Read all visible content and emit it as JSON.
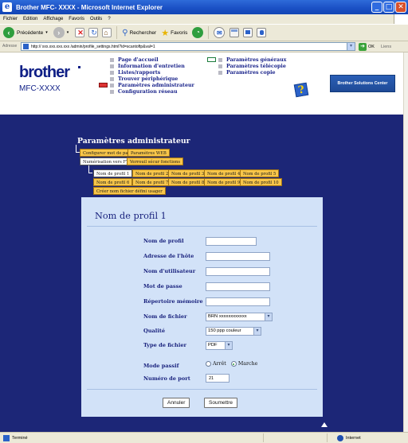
{
  "window": {
    "title": "Brother MFC- XXXX - Microsoft Internet Explorer",
    "min": "_",
    "max": "□",
    "close": "✕"
  },
  "menu": [
    "Fichier",
    "Edition",
    "Affichage",
    "Favoris",
    "Outils",
    "?"
  ],
  "toolbar": {
    "back": "Précédente",
    "search": "Rechercher",
    "favorites": "Favoris"
  },
  "address": {
    "label": "Adresse",
    "url": "http:// xxx.xxx.xxx.xxx /admin/profile_settings.html?id=scantoftp&val=1",
    "go": "OK",
    "links": "Liens"
  },
  "header": {
    "logo": "brother",
    "model": "MFC-XXXX",
    "nav_left": [
      "Page d'accueil",
      "Information d'entretien",
      "Listes/rapports",
      "Trouver périphérique",
      "Paramètres administrateur",
      "Configuration réseau"
    ],
    "nav_right": [
      "Paramètres généraux",
      "Paramètres télécopie",
      "Paramètres copie"
    ],
    "help": "?",
    "solutions_center": "Brother Solutions Center"
  },
  "section": {
    "title": "Paramètres administrateur",
    "tabs_row1": [
      "Configurer mot de passe",
      "Paramètres WEB"
    ],
    "tabs_row2": [
      "Numérisation vers FTP",
      "Verrouil sécur fonctions"
    ],
    "profiles_row1": [
      "Nom de profil 1",
      "Nom de profil 2",
      "Nom de profil 3",
      "Nom de profil 4",
      "Nom de profil 5"
    ],
    "profiles_row2": [
      "Nom de profil 6",
      "Nom de profil 7",
      "Nom de profil 8",
      "Nom de profil 9",
      "Nom de profil 10"
    ],
    "custom_filename": "Créer nom fichier défini usager"
  },
  "form": {
    "title": "Nom de profil 1",
    "profile_name_label": "Nom de profil",
    "host_address_label": "Adresse de l'hôte",
    "username_label": "Nom d'utilisateur",
    "password_label": "Mot de passe",
    "store_dir_label": "Répertoire mémoire",
    "filename_label": "Nom de fichier",
    "filename_value": "BRN xxxxxxxxxxxx",
    "quality_label": "Qualité",
    "quality_value": "150 ppp couleur",
    "filetype_label": "Type de fichier",
    "filetype_value": "PDF",
    "passive_label": "Mode passif",
    "passive_off": "Arrêt",
    "passive_on": "Marche",
    "port_label": "Numéro de port",
    "port_value": "21",
    "cancel": "Annuler",
    "submit": "Soumettre"
  },
  "status": {
    "left": "Terminé",
    "right": "Internet"
  }
}
